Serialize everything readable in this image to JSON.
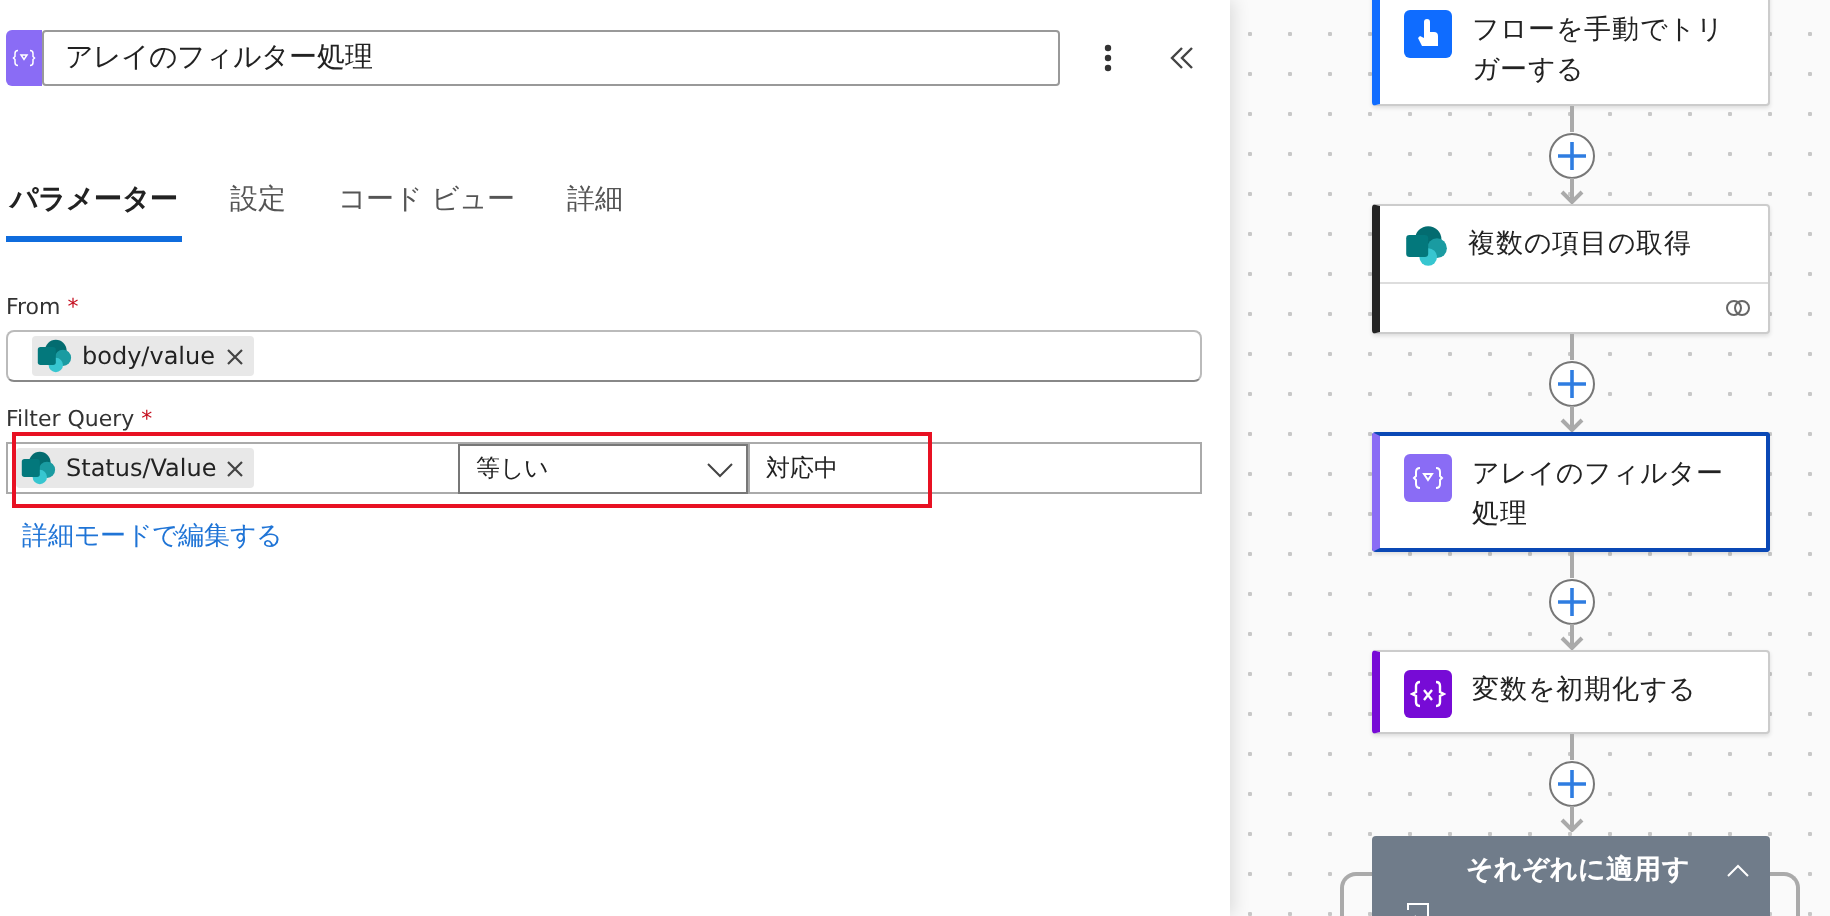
{
  "panel": {
    "title": "アレイのフィルター処理",
    "tabs": [
      {
        "label": "パラメーター",
        "selected": true
      },
      {
        "label": "設定",
        "selected": false
      },
      {
        "label": "コード ビュー",
        "selected": false
      },
      {
        "label": "詳細",
        "selected": false
      }
    ],
    "from": {
      "label": "From",
      "required": "*",
      "chip": "body/value"
    },
    "filter_query": {
      "label": "Filter Query",
      "required": "*",
      "chip": "Status/Value",
      "operator": "等しい",
      "value": "対応中",
      "highlighted": true
    },
    "advanced_link": "詳細モードで編集する"
  },
  "flow": {
    "nodes": [
      {
        "kind": "trigger",
        "title": "フローを手動でトリガーする",
        "color": "#0f6cff",
        "selected": false
      },
      {
        "kind": "sharepoint",
        "title": "複数の項目の取得",
        "color": "#242424",
        "selected": false
      },
      {
        "kind": "filter",
        "title": "アレイのフィルター処理",
        "color": "#8a6cf5",
        "selected": true
      },
      {
        "kind": "variable",
        "title": "変数を初期化する",
        "color": "#770bd6",
        "selected": false
      },
      {
        "kind": "loop",
        "title": "それぞれに適用す",
        "color": "#707c8a",
        "selected": false
      }
    ]
  }
}
